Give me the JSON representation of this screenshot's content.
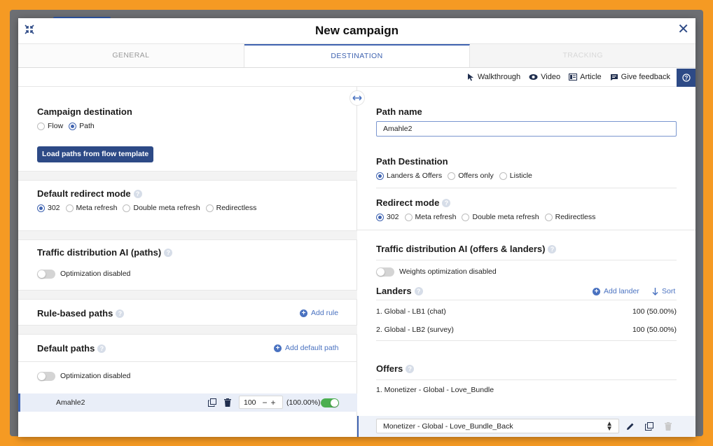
{
  "modal": {
    "title": "New campaign"
  },
  "tabs": [
    {
      "label": "GENERAL"
    },
    {
      "label": "DESTINATION"
    },
    {
      "label": "TRACKING"
    }
  ],
  "toolbar": {
    "walkthrough": "Walkthrough",
    "video": "Video",
    "article": "Article",
    "feedback": "Give feedback"
  },
  "left": {
    "campaign_destination": {
      "title": "Campaign destination",
      "options": [
        "Flow",
        "Path"
      ],
      "selected": "Path",
      "load_button": "Load paths from flow template"
    },
    "redirect": {
      "title": "Default redirect mode",
      "options": [
        "302",
        "Meta refresh",
        "Double meta refresh",
        "Redirectless"
      ],
      "selected": "302"
    },
    "traffic_ai": {
      "title": "Traffic distribution AI (paths)",
      "toggle_label": "Optimization disabled",
      "enabled": false
    },
    "rule_paths": {
      "title": "Rule-based paths",
      "add_label": "Add rule"
    },
    "default_paths": {
      "title": "Default paths",
      "add_label": "Add default path",
      "toggle_label": "Optimization disabled",
      "enabled": false,
      "rows": [
        {
          "name": "Amahle2",
          "weight": "100",
          "percent": "(100.00%)",
          "active": true
        }
      ]
    }
  },
  "right": {
    "path_name": {
      "title": "Path name",
      "value": "Amahle2"
    },
    "path_destination": {
      "title": "Path Destination",
      "options": [
        "Landers & Offers",
        "Offers only",
        "Listicle"
      ],
      "selected": "Landers & Offers"
    },
    "redirect": {
      "title": "Redirect mode",
      "options": [
        "302",
        "Meta refresh",
        "Double meta refresh",
        "Redirectless"
      ],
      "selected": "302"
    },
    "traffic_ai": {
      "title": "Traffic distribution AI (offers & landers)",
      "toggle_label": "Weights optimization disabled",
      "enabled": false
    },
    "landers": {
      "title": "Landers",
      "add_label": "Add lander",
      "sort_label": "Sort",
      "items": [
        {
          "name": "1. Global - LB1 (chat)",
          "weight": "100 (50.00%)"
        },
        {
          "name": "2. Global - LB2 (survey)",
          "weight": "100 (50.00%)"
        }
      ]
    },
    "offers": {
      "title": "Offers",
      "items": [
        {
          "name": "1. Monetizer - Global - Love_Bundle"
        }
      ],
      "select_value": "Monetizer - Global - Love_Bundle_Back"
    }
  },
  "colors": {
    "primary": "#2d4a86",
    "accent": "#3f63b0",
    "link": "#4a72c0",
    "toggle_on": "#4caf50"
  }
}
